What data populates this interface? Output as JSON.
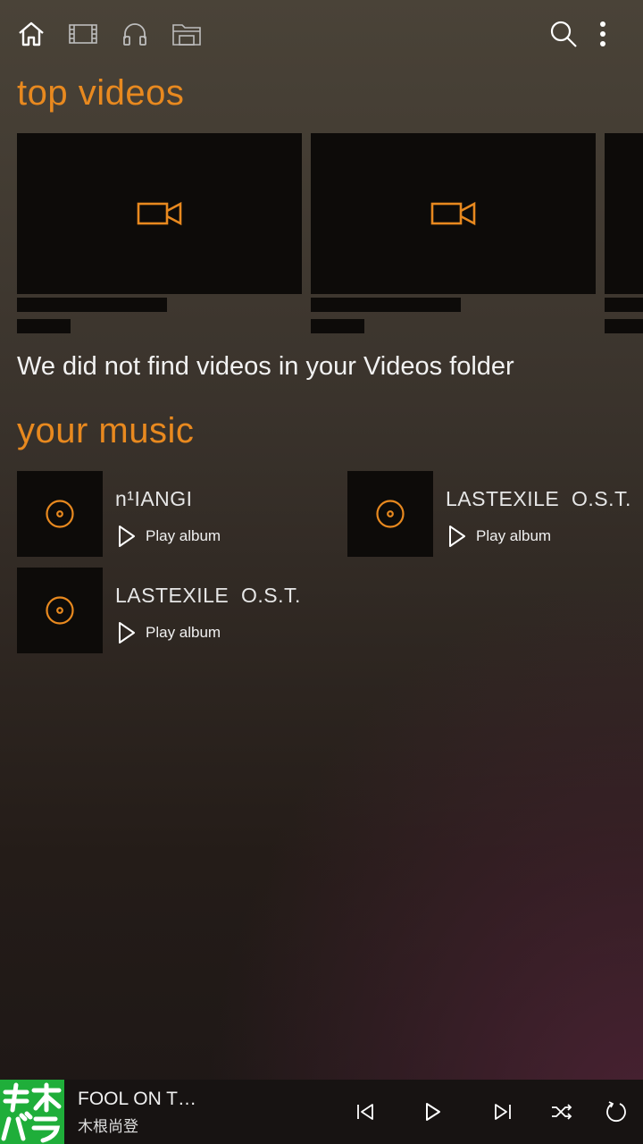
{
  "colors": {
    "accent": "#e8891f",
    "tile": "#0d0b09",
    "art_green": "#1fae3a"
  },
  "nav": {
    "icons": [
      "home-icon",
      "video-icon",
      "headphones-icon",
      "folder-icon"
    ],
    "actions": [
      "search-icon",
      "more-options-icon"
    ]
  },
  "videos": {
    "title": "top videos",
    "empty_message": "We did not find videos in your Videos folder"
  },
  "music": {
    "title": "your music",
    "albums": [
      {
        "title": "n¹IANGI",
        "action": "Play album"
      },
      {
        "title": "LASTEXILE  O.S.T.",
        "action": "Play album"
      },
      {
        "title": "LASTEXILE  O.S.T.",
        "action": "Play album"
      }
    ]
  },
  "player": {
    "title": "FOOL ON T…",
    "artist": "木根尚登",
    "art_text": "キネバラ",
    "controls": [
      "previous-icon",
      "play-icon",
      "next-icon",
      "shuffle-icon",
      "repeat-icon"
    ]
  }
}
